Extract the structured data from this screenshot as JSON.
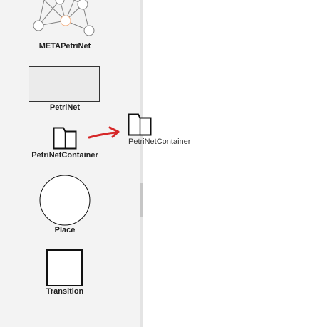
{
  "palette": {
    "items": [
      {
        "label": "METAPetriNet",
        "icon": "network-graph-icon"
      },
      {
        "label": "PetriNet",
        "icon": "rectangle-icon"
      },
      {
        "label": "PetriNetContainer",
        "icon": "folder-icon"
      },
      {
        "label": "Place",
        "icon": "circle-icon"
      },
      {
        "label": "Transition",
        "icon": "square-icon"
      }
    ]
  },
  "canvas": {
    "dropped_element": {
      "label": "PetriNetContainer",
      "icon": "folder-icon"
    },
    "drag_arrow": {
      "color": "#d62728",
      "icon": "arrow-icon"
    }
  },
  "colors": {
    "palette_background": "#f3f3f3",
    "canvas_background": "#ffffff",
    "petrinet_fill": "#ebebeb",
    "highlight_node": "#f4b183"
  }
}
